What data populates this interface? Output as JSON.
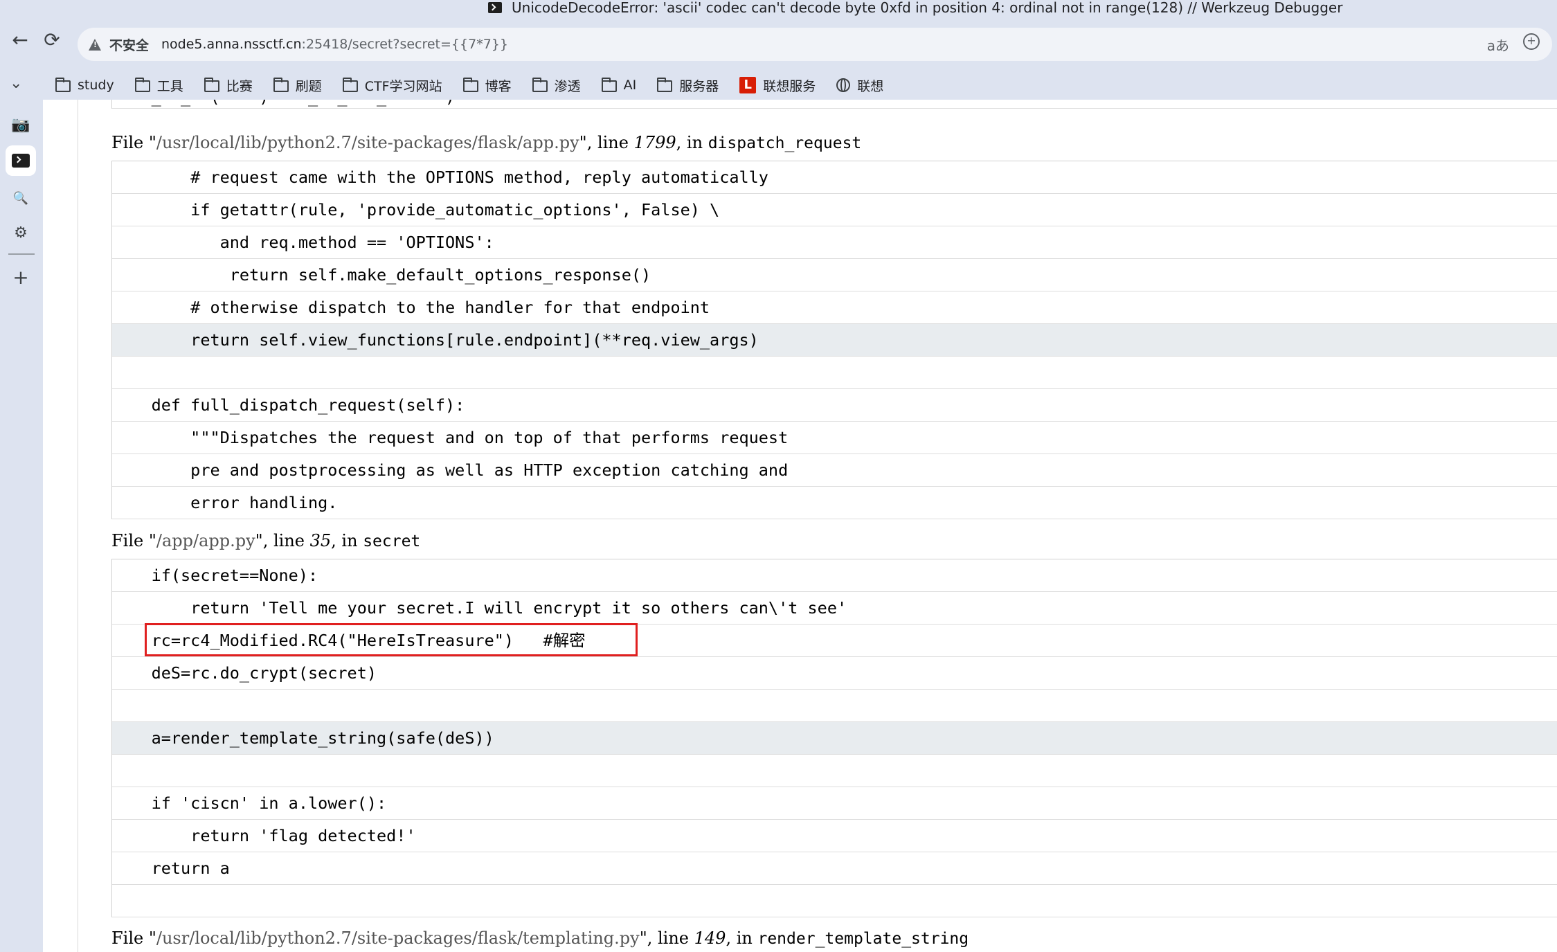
{
  "window": {
    "title": "UnicodeDecodeError: 'ascii' codec can't decode byte 0xfd in position 4: ordinal not in range(128) // Werkzeug Debugger"
  },
  "navbar": {
    "back_icon": "arrow-left-icon",
    "reload_icon": "reload-icon",
    "security_label": "不安全",
    "url_host": "node5.anna.nssctf.cn",
    "url_rest": ":25418/secret?secret={{7*7}}",
    "translate_icon": "translate-icon",
    "zoom_icon": "zoom-icon"
  },
  "bookmarks": [
    {
      "label": "study",
      "icon": "folder-icon"
    },
    {
      "label": "工具",
      "icon": "folder-icon"
    },
    {
      "label": "比赛",
      "icon": "folder-icon"
    },
    {
      "label": "刷题",
      "icon": "folder-icon"
    },
    {
      "label": "CTF学习网站",
      "icon": "folder-icon"
    },
    {
      "label": "博客",
      "icon": "folder-icon"
    },
    {
      "label": "渗透",
      "icon": "folder-icon"
    },
    {
      "label": "AI",
      "icon": "folder-icon"
    },
    {
      "label": "服务器",
      "icon": "folder-icon"
    },
    {
      "label": "联想服务",
      "icon": "lenovo-l-icon"
    },
    {
      "label": "联想",
      "icon": "globe-icon"
    }
  ],
  "sidebar": {
    "icons": [
      "chevron-down-icon",
      "image-search-icon",
      "terminal-icon",
      "search-icon",
      "extension-icon",
      "plus-icon"
    ]
  },
  "frames": [
    {
      "header": {
        "prefix": "File \"",
        "filename": "/usr/local/lib/python2.7/site-packages/flask/app.py",
        "mid": "\", line ",
        "lineno": "1799",
        "mid2": ", in ",
        "func": "dispatch_request"
      },
      "lines": [
        {
          "text": "        # request came with the OPTIONS method, reply automatically",
          "current": false
        },
        {
          "text": "        if getattr(rule, 'provide_automatic_options', False) \\",
          "current": false
        },
        {
          "text": "           and req.method == 'OPTIONS':",
          "current": false
        },
        {
          "text": "            return self.make_default_options_response()",
          "current": false
        },
        {
          "text": "        # otherwise dispatch to the handler for that endpoint",
          "current": false
        },
        {
          "text": "        return self.view_functions[rule.endpoint](**req.view_args)",
          "current": true
        },
        {
          "text": "",
          "current": false
        },
        {
          "text": "    def full_dispatch_request(self):",
          "current": false
        },
        {
          "text": "        \"\"\"Dispatches the request and on top of that performs request",
          "current": false
        },
        {
          "text": "        pre and postprocessing as well as HTTP exception catching and",
          "current": false
        },
        {
          "text": "        error handling.",
          "current": false
        }
      ]
    },
    {
      "header": {
        "prefix": "File \"",
        "filename": "/app/app.py",
        "mid": "\", line ",
        "lineno": "35",
        "mid2": ", in ",
        "func": "secret"
      },
      "lines": [
        {
          "text": "    if(secret==None):",
          "current": false
        },
        {
          "text": "        return 'Tell me your secret.I will encrypt it so others can\\'t see'",
          "current": false
        },
        {
          "text": "    rc=rc4_Modified.RC4(\"HereIsTreasure\")   #解密",
          "current": false
        },
        {
          "text": "    deS=rc.do_crypt(secret)",
          "current": false
        },
        {
          "text": "",
          "current": false
        },
        {
          "text": "    a=render_template_string(safe(deS))",
          "current": true
        },
        {
          "text": "",
          "current": false
        },
        {
          "text": "    if 'ciscn' in a.lower():",
          "current": false
        },
        {
          "text": "        return 'flag detected!'",
          "current": false
        },
        {
          "text": "    return a",
          "current": false
        },
        {
          "text": "",
          "current": false
        }
      ]
    },
    {
      "header": {
        "prefix": "File \"",
        "filename": "/usr/local/lib/python2.7/site-packages/flask/templating.py",
        "mid": "\", line ",
        "lineno": "149",
        "mid2": ", in ",
        "func": "render_template_string"
      },
      "lines": []
    }
  ],
  "partial_top_line": "    _  _  (    )    _  _   _      )",
  "colors": {
    "chrome_bg": "#dde3f0",
    "highlight_border": "#e02020",
    "current_line_bg": "#e8ecef",
    "filename_color": "#555555"
  }
}
